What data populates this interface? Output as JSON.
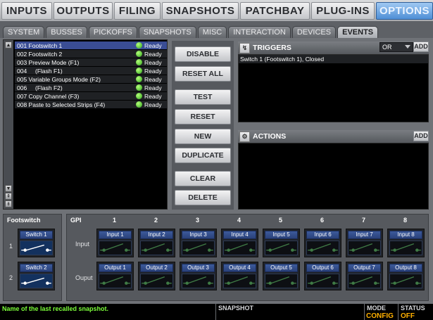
{
  "top_tabs": [
    "INPUTS",
    "OUTPUTS",
    "FILING",
    "SNAPSHOTS",
    "PATCHBAY",
    "PLUG-INS",
    "OPTIONS"
  ],
  "sub_tabs": [
    "SYSTEM",
    "BUSSES",
    "PICKOFFS",
    "SNAPSHOTS",
    "MISC",
    "INTERACTION",
    "DEVICES",
    "EVENTS"
  ],
  "snapshots": [
    {
      "name": "001 Footswitch 1",
      "status": "Ready"
    },
    {
      "name": "002 Footswitch 2",
      "status": "Ready"
    },
    {
      "name": "003 Preview Mode (F1)",
      "status": "Ready"
    },
    {
      "name": "004     (Flash F1)",
      "status": "Ready"
    },
    {
      "name": "005 Variable Groups Mode (F2)",
      "status": "Ready"
    },
    {
      "name": "006     (Flash F2)",
      "status": "Ready"
    },
    {
      "name": "007 Copy Channel (F3)",
      "status": "Ready"
    },
    {
      "name": "008 Paste to Selected Strips (F4)",
      "status": "Ready"
    }
  ],
  "buttons": {
    "disable": "DISABLE",
    "reset_all": "RESET ALL",
    "test": "TEST",
    "reset": "RESET",
    "new": "NEW",
    "duplicate": "DUPLICATE",
    "clear": "CLEAR",
    "delete": "DELETE"
  },
  "triggers": {
    "title": "TRIGGERS",
    "operator": "OR",
    "add": "ADD",
    "items": [
      "Switch 1 (Footswitch 1), Closed"
    ]
  },
  "actions": {
    "title": "ACTIONS",
    "add": "ADD"
  },
  "footswitch": {
    "title": "Footswitch",
    "rows": [
      "1",
      "2"
    ],
    "switches": [
      "Switch 1",
      "Switch 2"
    ]
  },
  "gpi": {
    "title": "GPI",
    "columns": [
      "1",
      "2",
      "3",
      "4",
      "5",
      "6",
      "7",
      "8"
    ],
    "input_label": "Input",
    "output_label": "Ouput",
    "inputs": [
      "Input 1",
      "Input 2",
      "Input 3",
      "Input 4",
      "Input 5",
      "Input 6",
      "Input 7",
      "Input 8"
    ],
    "outputs": [
      "Output 1",
      "Output 2",
      "Output 3",
      "Output 4",
      "Output 5",
      "Output 6",
      "Output 7",
      "Output 8"
    ]
  },
  "status_bar": {
    "message": "Name of the last recalled snapshot.",
    "snapshot_label": "SNAPSHOT",
    "mode_label": "MODE",
    "mode_value": "CONFIG",
    "status_label": "STATUS",
    "status_value": "OFF"
  },
  "colors": {
    "accent_active_tab": "#4f8fd6",
    "led_green": "#2ea51a",
    "message_green": "#7cff3a",
    "status_orange": "#ffb000"
  }
}
